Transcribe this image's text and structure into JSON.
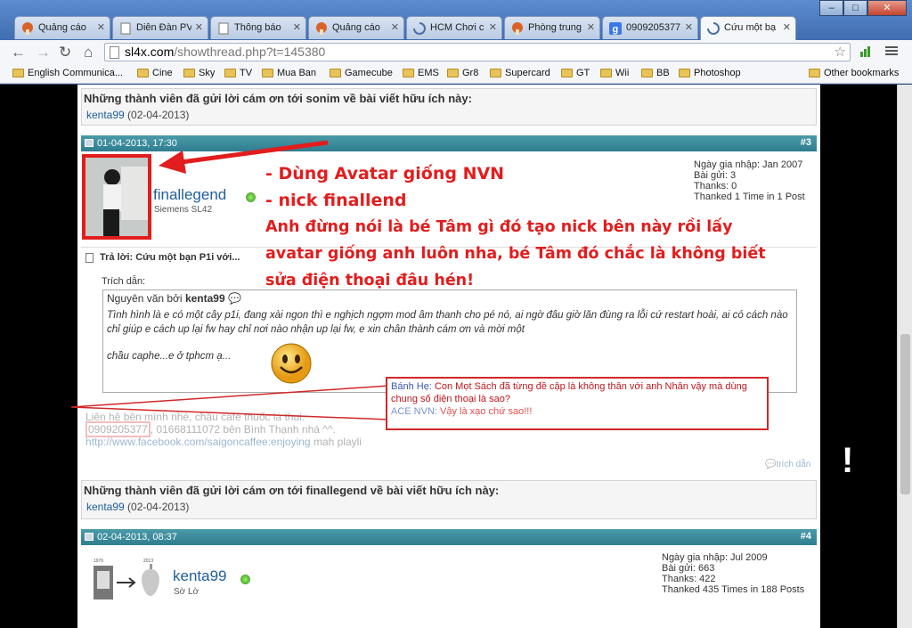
{
  "browser": {
    "tabs": [
      {
        "label": "Quảng cáo",
        "icon": "favicon-mushroom"
      },
      {
        "label": "Diễn Đàn PV",
        "icon": "favicon-doc"
      },
      {
        "label": "Thông báo",
        "icon": "favicon-doc"
      },
      {
        "label": "Quảng cáo",
        "icon": "favicon-mushroom"
      },
      {
        "label": "HCM Chơi c",
        "icon": "loading-spinner"
      },
      {
        "label": "Phòng trung",
        "icon": "favicon-mushroom"
      },
      {
        "label": "0909205377",
        "icon": "google-favicon"
      },
      {
        "label": "Cứu một bạ",
        "icon": "loading-spinner"
      }
    ],
    "url_host": "sl4x.com",
    "url_rest": "/showthread.php?t=145380",
    "bookmarks": [
      "English Communica...",
      "Cine",
      "Sky",
      "TV",
      "Mua Ban",
      "Gamecube",
      "EMS",
      "Gr8",
      "Supercard",
      "GT",
      "Wii",
      "BB",
      "Photoshop"
    ],
    "other_bookmarks": "Other bookmarks"
  },
  "thanks_top": {
    "title": "Những thành viên đã gửi lời cám ơn tới sonim về bài viết hữu ích này:",
    "user": "kenta99",
    "date": "(02-04-2013)"
  },
  "post3": {
    "timestamp": "01-04-2013, 17:30",
    "number": "#3",
    "username": "finallegend",
    "user_title": "Siemens SL42",
    "join_date": "Ngày gia nhập: Jan 2007",
    "posts": "Bài gửi: 3",
    "thanks": "Thanks: 0",
    "thanked": "Thanked 1 Time in 1 Post",
    "reply_title": "Trả lời: Cứu một bạn P1i với...",
    "quote_label": "Trích dẫn:",
    "quote_by_prefix": "Nguyên văn bởi",
    "quote_by_user": "kenta99",
    "quote_text": "Tình hình là e có một cây p1i, đang xài ngon thì e nghịch ngợm mod âm thanh cho pé nó, ai ngờ đâu giờ lăn đùng ra lỗi cứ restart hoài, ai có cách nào chỉ giúp e cách up lại fw hay chỉ nơi nào nhận up lại fw, e xin chân thành cám ơn và mời một",
    "quote_text2": "chầu caphe...e ở tphcm ạ...",
    "sig_line1": "Liên hệ bên mình nhé, chầu cafe thuốc lá thui.",
    "sig_phone": "0909205377",
    "sig_line2_rest": ", 01668111072 bên Bình Thạnh nhá ^^.",
    "sig_link": "http://www.facebook.com/saigoncaffee:enjoying",
    "sig_link_tail": "mah playli",
    "reply_button": "trích dẫn"
  },
  "annotation": {
    "line1": "- Dùng Avatar giống NVN",
    "line2": "- nick finallend",
    "line3": "Anh đừng nói là bé Tâm gì đó tạo nick bên này rồi lấy",
    "line4": "avatar giống anh luôn nha, bé Tâm đó chắc là không biết",
    "line5": "sửa điện thoại đâu hén!"
  },
  "note": {
    "speaker1": "Bánh Hẹ:",
    "msg1": "Con Mọt Sách đã từng đề cập là không thân với anh Nhân vậy mà dùng chung số điện thoại là sao?",
    "speaker2": "ACE NVN:",
    "msg2": "Vậy là xạo chứ sao!!!"
  },
  "thanks_mid": {
    "title": "Những thành viên đã gửi lời cám ơn tới finallegend về bài viết hữu ích này:",
    "user": "kenta99",
    "date": "(02-04-2013)"
  },
  "post4": {
    "timestamp": "02-04-2013, 08:37",
    "number": "#4",
    "username": "kenta99",
    "user_title": "Sờ Lờ",
    "avatar_year1": "1976",
    "avatar_year2": "2013",
    "join_date": "Ngày gia nhập: Jul 2009",
    "posts": "Bài gửi: 663",
    "thanks": "Thanks: 422",
    "thanked": "Thanked 435 Times in 188 Posts"
  },
  "colors": {
    "annotation_red": "#e21d1d",
    "link_blue": "#1d5e9b",
    "post_header_teal": "#2f7e90"
  }
}
